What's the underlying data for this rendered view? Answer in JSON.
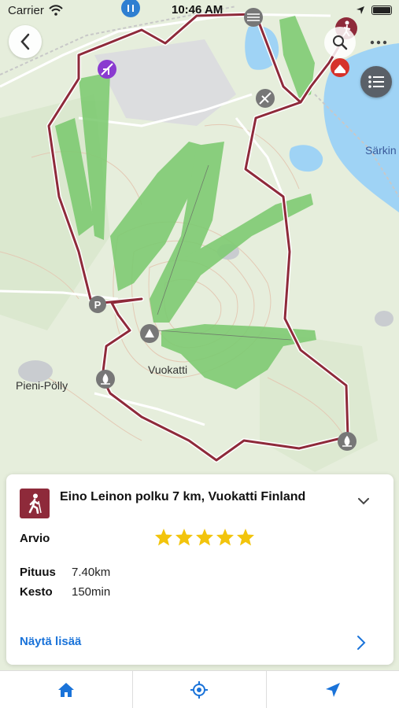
{
  "status_bar": {
    "carrier": "Carrier",
    "time": "10:46 AM"
  },
  "map": {
    "labels": {
      "town": "Vuokatti",
      "lake": "Särkin",
      "pond": "Pieni-Pölly"
    },
    "route_color": "#8e2a3a",
    "slope_color": "#7fcb73",
    "water_color": "#9fd3f5"
  },
  "card": {
    "title": "Eino Leinon polku 7 km, Vuokatti Finland",
    "rating_label": "Arvio",
    "rating": 5,
    "length_label": "Pituus",
    "length_value": "7.40km",
    "duration_label": "Kesto",
    "duration_value": "150min",
    "more_link": "Näytä lisää"
  },
  "tabbar": {
    "tabs": [
      {
        "name": "home",
        "icon": "home-icon"
      },
      {
        "name": "locate",
        "icon": "target-icon"
      },
      {
        "name": "navigate",
        "icon": "navigation-arrow-icon"
      }
    ],
    "accent": "#1a73d9"
  }
}
